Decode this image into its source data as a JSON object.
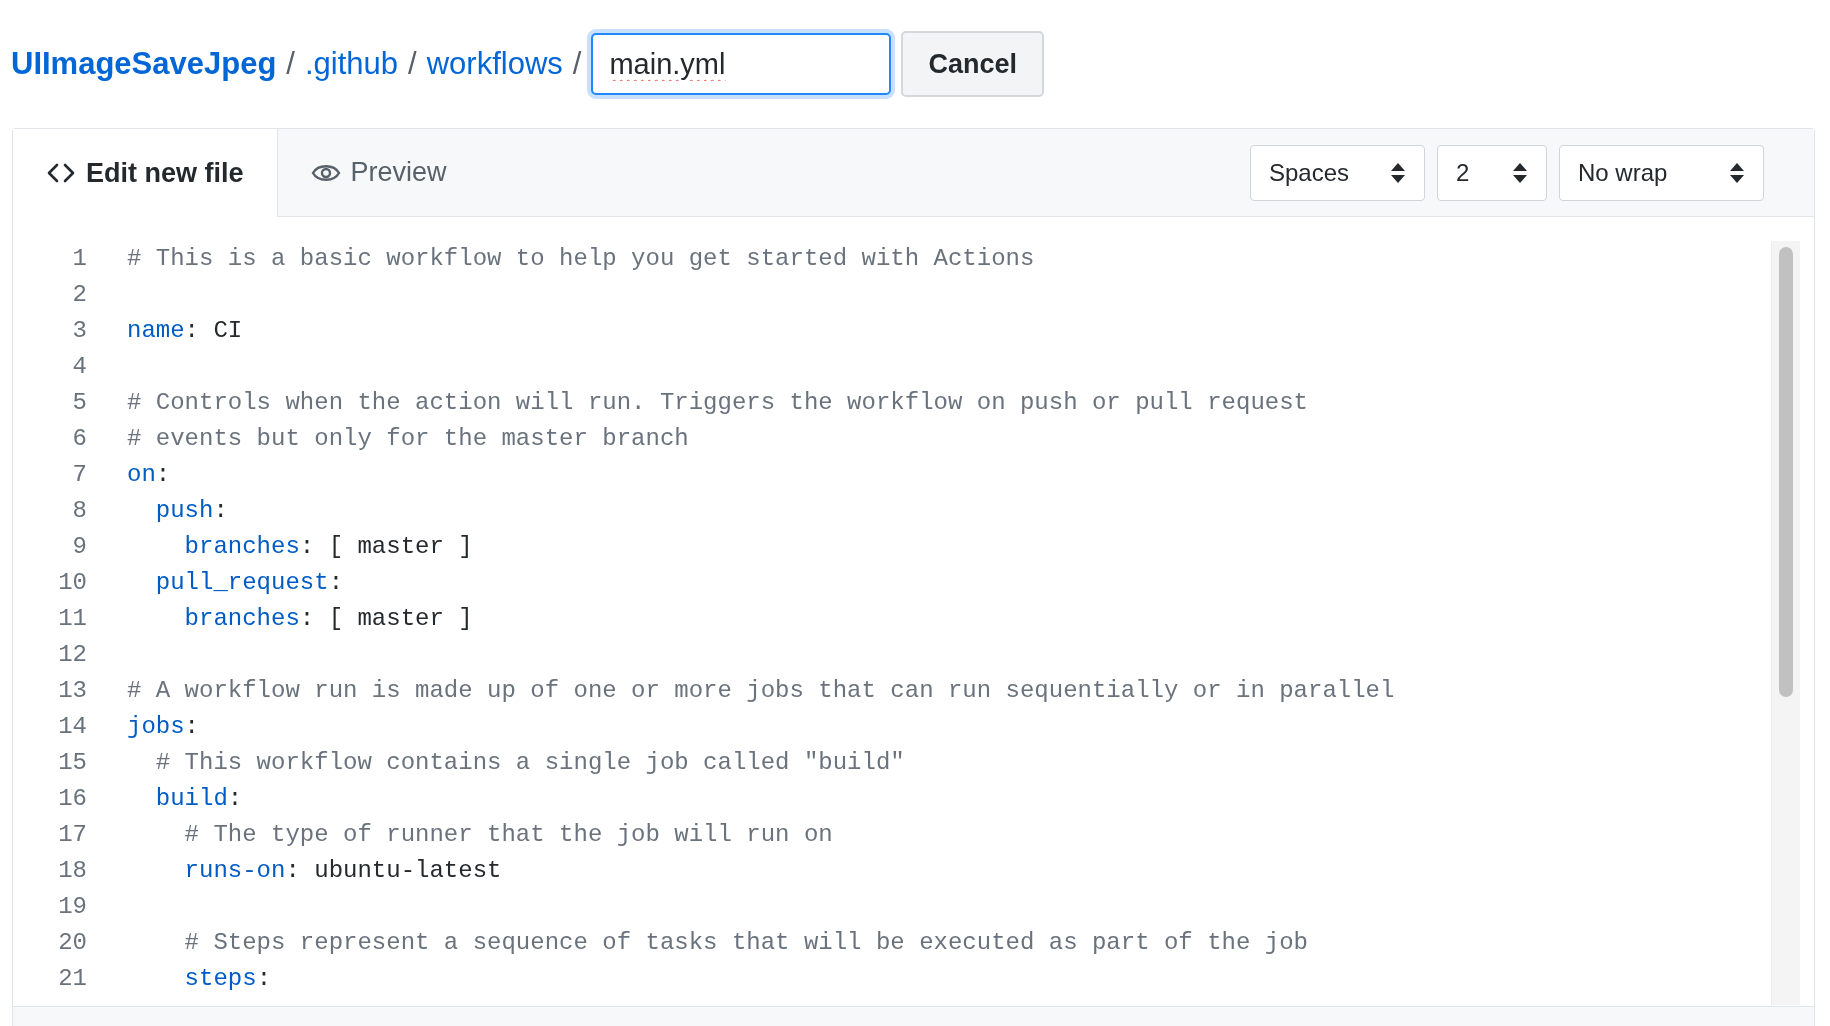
{
  "breadcrumb": [
    {
      "text": "UIImageSaveJpeg",
      "kind": "repo"
    },
    {
      "text": ".github",
      "kind": "dir"
    },
    {
      "text": "workflows",
      "kind": "dir"
    }
  ],
  "separator": "/",
  "filename": {
    "value": "main.yml"
  },
  "cancel_button": "Cancel",
  "tabs": [
    {
      "label": "Edit new file",
      "selected": true
    },
    {
      "label": "Preview",
      "selected": false
    }
  ],
  "selects": [
    {
      "value": "Spaces"
    },
    {
      "value": "2"
    },
    {
      "value": "No wrap"
    }
  ],
  "editor": {
    "lines": [
      {
        "number": "1",
        "tokens": [
          {
            "kind": "comment",
            "text": "# This is a basic workflow to help you get started with Actions"
          }
        ]
      },
      {
        "number": "2"
      },
      {
        "number": "3",
        "tokens": [
          {
            "kind": "key",
            "text": "name"
          },
          {
            "kind": "plain",
            "text": ": CI"
          }
        ]
      },
      {
        "number": "4"
      },
      {
        "number": "5",
        "tokens": [
          {
            "kind": "comment",
            "text": "# Controls when the action will run. Triggers the workflow on push or pull request"
          }
        ]
      },
      {
        "number": "6",
        "tokens": [
          {
            "kind": "comment",
            "text": "# events but only for the master branch"
          }
        ]
      },
      {
        "number": "7",
        "tokens": [
          {
            "kind": "key",
            "text": "on"
          },
          {
            "kind": "plain",
            "text": ":"
          }
        ]
      },
      {
        "number": "8",
        "tokens": [
          {
            "kind": "key",
            "text": "  push"
          },
          {
            "kind": "plain",
            "text": ":"
          }
        ]
      },
      {
        "number": "9",
        "tokens": [
          {
            "kind": "key",
            "text": "    branches"
          },
          {
            "kind": "plain",
            "text": ": [ master ]"
          }
        ]
      },
      {
        "number": "10",
        "tokens": [
          {
            "kind": "key",
            "text": "  pull_request"
          },
          {
            "kind": "plain",
            "text": ":"
          }
        ]
      },
      {
        "number": "11",
        "tokens": [
          {
            "kind": "key",
            "text": "    branches"
          },
          {
            "kind": "plain",
            "text": ": [ master ]"
          }
        ]
      },
      {
        "number": "12"
      },
      {
        "number": "13",
        "tokens": [
          {
            "kind": "comment",
            "text": "# A workflow run is made up of one or more jobs that can run sequentially or in parallel"
          }
        ]
      },
      {
        "number": "14",
        "tokens": [
          {
            "kind": "key",
            "text": "jobs"
          },
          {
            "kind": "plain",
            "text": ":"
          }
        ]
      },
      {
        "number": "15",
        "tokens": [
          {
            "kind": "comment",
            "text": "  # This workflow contains a single job called \"build\""
          }
        ]
      },
      {
        "number": "16",
        "tokens": [
          {
            "kind": "key",
            "text": "  build"
          },
          {
            "kind": "plain",
            "text": ":"
          }
        ]
      },
      {
        "number": "17",
        "tokens": [
          {
            "kind": "comment",
            "text": "    # The type of runner that the job will run on"
          }
        ]
      },
      {
        "number": "18",
        "tokens": [
          {
            "kind": "key",
            "text": "    runs-on"
          },
          {
            "kind": "plain",
            "text": ": ubuntu-latest"
          }
        ]
      },
      {
        "number": "19"
      },
      {
        "number": "20",
        "tokens": [
          {
            "kind": "comment",
            "text": "    # Steps represent a sequence of tasks that will be executed as part of the job"
          }
        ]
      },
      {
        "number": "21",
        "tokens": [
          {
            "kind": "key",
            "text": "    steps"
          },
          {
            "kind": "plain",
            "text": ":"
          }
        ]
      }
    ]
  }
}
